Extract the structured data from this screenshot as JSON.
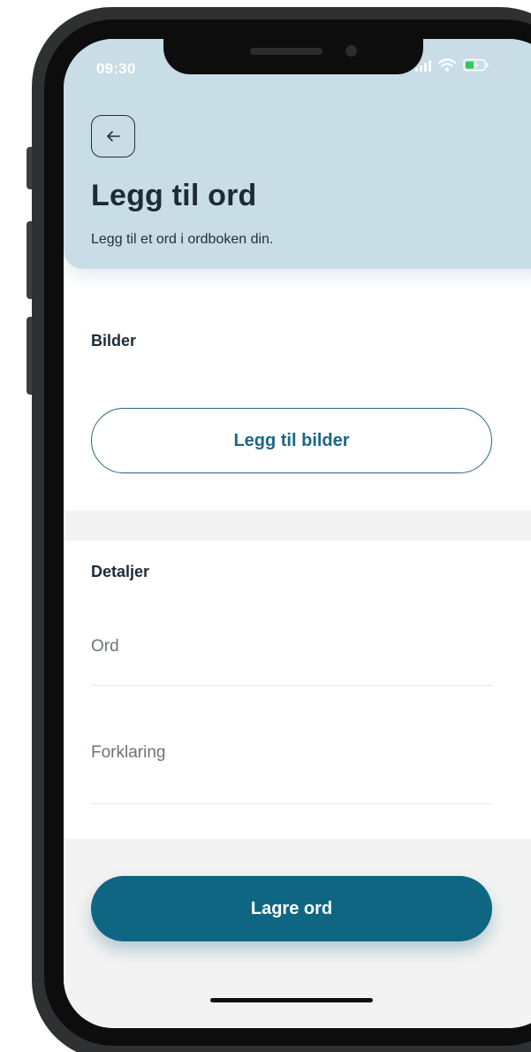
{
  "status_bar": {
    "time": "09:30"
  },
  "header": {
    "back_icon": "arrow-left-icon",
    "title": "Legg til ord",
    "subtitle": "Legg til et ord i ordboken din."
  },
  "images_section": {
    "label": "Bilder",
    "add_button_label": "Legg til bilder"
  },
  "details_section": {
    "label": "Detaljer",
    "word_field": {
      "placeholder": "Ord",
      "value": ""
    },
    "explanation_field": {
      "placeholder": "Forklaring",
      "value": ""
    }
  },
  "actions": {
    "save_label": "Lagre ord"
  },
  "colors": {
    "header_bg": "#c8dde6",
    "primary": "#0f6683",
    "text_dark": "#1d2b35",
    "band_gray": "#f3f3f3"
  }
}
